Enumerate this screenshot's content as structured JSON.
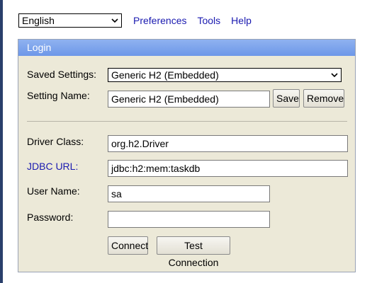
{
  "topbar": {
    "language": "English",
    "links": [
      "Preferences",
      "Tools",
      "Help"
    ]
  },
  "login": {
    "title": "Login",
    "saved_settings_label": "Saved Settings:",
    "saved_settings_value": "Generic H2 (Embedded)",
    "setting_name_label": "Setting Name:",
    "setting_name_value": "Generic H2 (Embedded)",
    "save_label": "Save",
    "remove_label": "Remove",
    "driver_class_label": "Driver Class:",
    "driver_class_value": "org.h2.Driver",
    "jdbc_url_label": "JDBC URL:",
    "jdbc_url_value": "jdbc:h2:mem:taskdb",
    "user_name_label": "User Name:",
    "user_name_value": "sa",
    "password_label": "Password:",
    "password_value": "",
    "connect_label": "Connect",
    "test_connection_label": "Test Connection"
  },
  "colors": {
    "header_blue": "#6d97e8",
    "panel_bg": "#ece9d8",
    "link_blue": "#1a1ab0"
  }
}
